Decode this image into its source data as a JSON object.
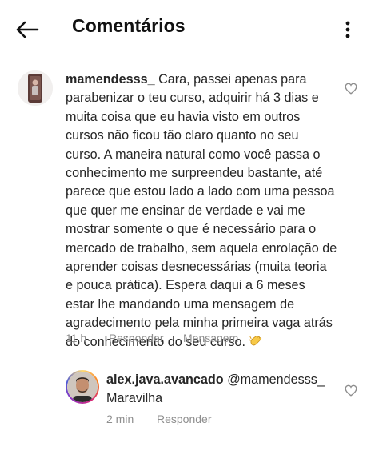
{
  "header": {
    "title": "Comentários",
    "back_icon": "arrow-left-icon",
    "more_icon": "more-vertical-icon"
  },
  "comment": {
    "username": "mamendesss_",
    "text": "Cara, passei apenas para parabenizar o teu curso, adquirir há 3 dias e muita coisa que eu havia visto em outros cursos não ficou tão claro quanto no seu curso. A maneira natural como você passa o conhecimento me surpreendeu bastante, até parece que estou lado a lado com uma pessoa que quer me ensinar de verdade e vai me mostrar somente o que é necessário para o mercado de trabalho, sem aquela enrolação de aprender coisas desnecessárias (muita teoria e pouca prática). Espera daqui a 6 meses estar lhe mandando uma mensagem de agradecimento pela minha primeira vaga atrás do conhecimento do seu curso.",
    "emoji_icon": "clapping-hands-icon",
    "time": "11 h",
    "reply_label": "Responder",
    "message_label": "Mensagem",
    "like_icon": "heart-outline-icon"
  },
  "reply": {
    "username": "alex.java.avancado",
    "mention": "@mamendesss_",
    "text": "Maravilha",
    "time": "2 min",
    "reply_label": "Responder",
    "like_icon": "heart-outline-icon"
  },
  "colors": {
    "text": "#262626",
    "meta": "#8e8e8e"
  }
}
